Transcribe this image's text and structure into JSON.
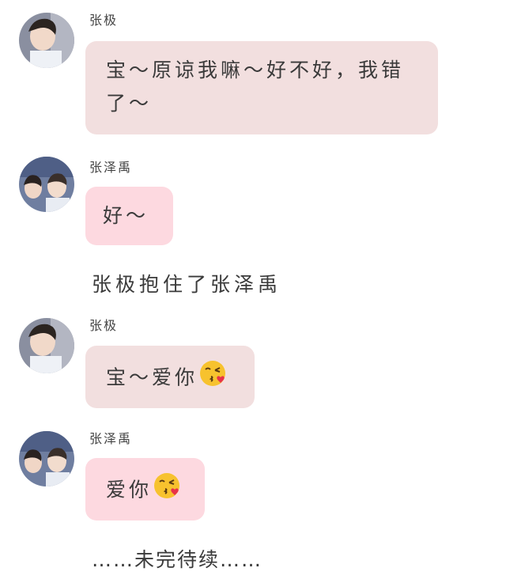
{
  "messages": [
    {
      "sender": "张极",
      "text": "宝～原谅我嘛～好不好，我错了～",
      "emoji": ""
    },
    {
      "sender": "张泽禹",
      "text": "好～",
      "emoji": ""
    },
    {
      "sender": "张极",
      "text": "宝～爱你",
      "emoji": "kissing-face-emoji"
    },
    {
      "sender": "张泽禹",
      "text": "爱你",
      "emoji": "kissing-face-emoji"
    }
  ],
  "narration": "张极抱住了张泽禹",
  "ending": "……未完待续……",
  "colors": {
    "bubble_a": "#f2dfdf",
    "bubble_b": "#fdd9e0"
  }
}
